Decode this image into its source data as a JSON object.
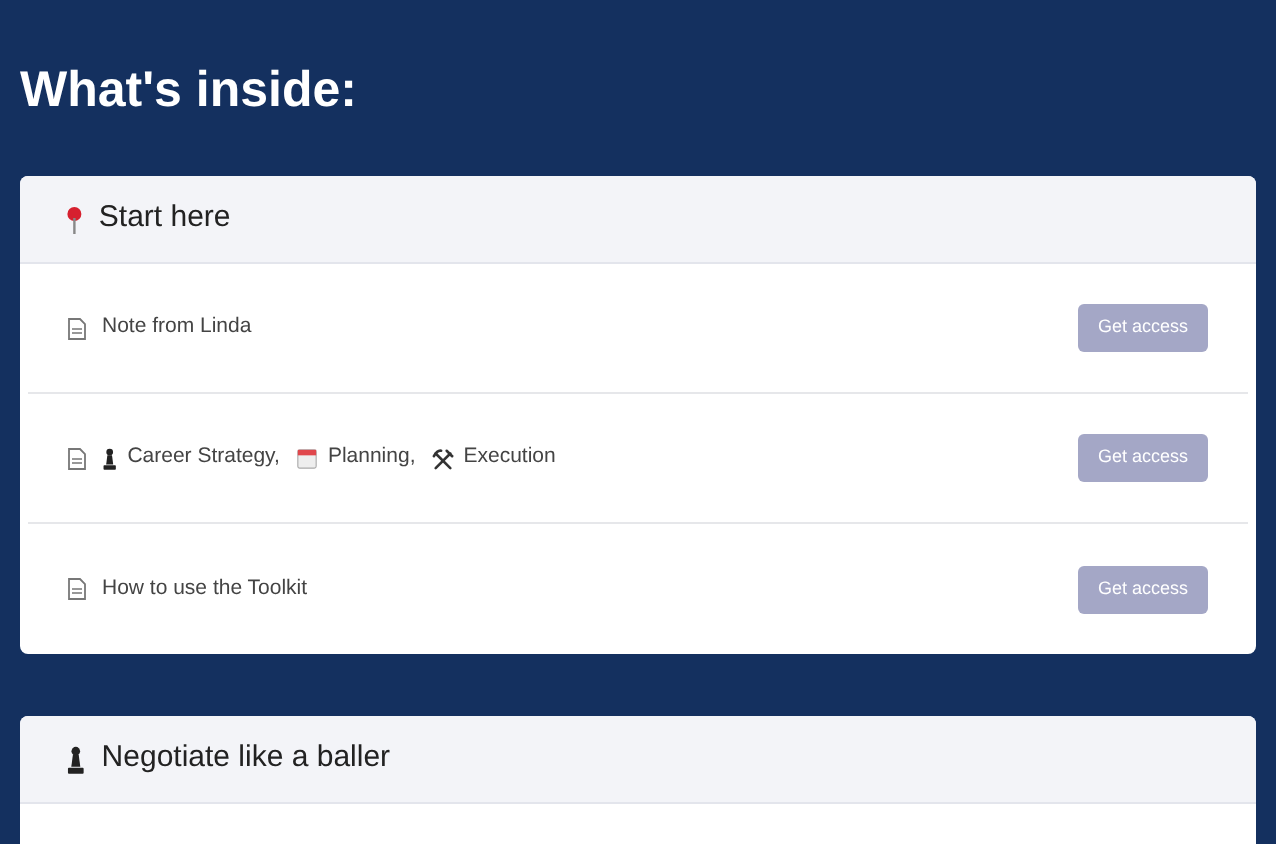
{
  "heading": "What's inside:",
  "sections": [
    {
      "title": "Start here",
      "kind": "pin",
      "items": [
        {
          "segments": [
            {
              "kind": "plain",
              "text": "Note from Linda"
            }
          ],
          "button": "Get access",
          "disabled": true
        },
        {
          "segments": [
            {
              "kind": "chess",
              "text": "Career Strategy,"
            },
            {
              "kind": "calendar",
              "text": "Planning,"
            },
            {
              "kind": "tools",
              "text": "Execution"
            }
          ],
          "button": "Get access",
          "disabled": true
        },
        {
          "segments": [
            {
              "kind": "plain",
              "text": "How to use the Toolkit"
            }
          ],
          "button": "Get access",
          "disabled": true
        }
      ]
    },
    {
      "title": "Negotiate like a baller",
      "kind": "chess"
    }
  ]
}
